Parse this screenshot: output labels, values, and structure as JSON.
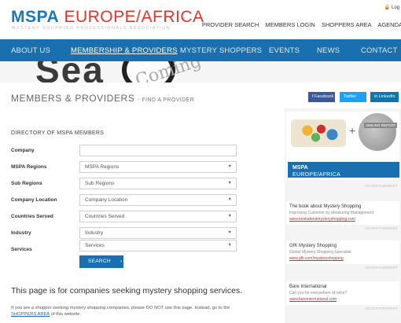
{
  "header": {
    "logo_mspa": "MSPA",
    "logo_rest": "EUROPE/AFRICA",
    "tagline": "MYSTERY SHOPPING PROFESSIONALS ASSOCIATION",
    "login": "Log",
    "links": [
      "PROVIDER SEARCH",
      "MEMBERS LOGIN",
      "SHOPPERS AREA",
      "AGENDA"
    ]
  },
  "nav": {
    "items": [
      "ABOUT US",
      "MEMBERSHIP & PROVIDERS",
      "MYSTERY SHOPPERS",
      "EVENTS",
      "NEWS",
      "CONTACT"
    ],
    "active_index": 1
  },
  "hero": {
    "word": "Sea",
    "lens_text": "Coming"
  },
  "page": {
    "title": "MEMBERS & PROVIDERS",
    "subtitle": "- FIND A PROVIDER"
  },
  "share": {
    "facebook": "f  Facebook",
    "twitter": "Twitter",
    "linkedin": "in  LinkedIn"
  },
  "directory": {
    "heading": "DIRECTORY OF MSPA MEMBERS",
    "fields": [
      {
        "label": "Company",
        "value": "",
        "type": "text"
      },
      {
        "label": "MSPA Regions",
        "value": "MSPA Regions",
        "type": "select"
      },
      {
        "label": "Sub Regions",
        "value": "Sub Regions",
        "type": "select"
      },
      {
        "label": "Company Location",
        "value": "Company Location",
        "type": "select"
      },
      {
        "label": "Countries Served",
        "value": "Countries Served",
        "type": "select"
      },
      {
        "label": "Industry",
        "value": "Industry",
        "type": "select"
      },
      {
        "label": "Services",
        "value": "Services",
        "type": "select"
      }
    ],
    "search_label": "SEARCH",
    "search_arrow": "›"
  },
  "info": {
    "heading": "This page is for companies seeking mystery shopping services.",
    "text_before": "If you are a shopper seeking mystery shopping companies, please DO NOT use this page. Instead, go to the ",
    "link_text": "SHOPPERS AREA",
    "text_after": " of this website."
  },
  "sidebar": {
    "banner_title": "MSPA",
    "banner_sub": "EUROPE/AFRICA",
    "banner_ribbon": "SMILING REPORT",
    "advertisement": "ADVERTISEMENT",
    "ads": [
      {
        "title": "The book about Mystery Shopping",
        "desc": "Improving Customer by Measuring Management",
        "link": "www.bookaboutmysteryshopping.com"
      },
      {
        "title": "GfK Mystery Shopping",
        "desc": "Global Mystery Shopping Specialist",
        "link": "www.gfk.com/mysteryshopping"
      },
      {
        "title": "Bare International",
        "desc": "Can you be everywhere at once?",
        "link": "www.bareinternational.com"
      }
    ]
  },
  "colors": {
    "brand_blue": "#1a6fae",
    "logo_red": "#e1342b",
    "logo_blue": "#1a78b8"
  }
}
